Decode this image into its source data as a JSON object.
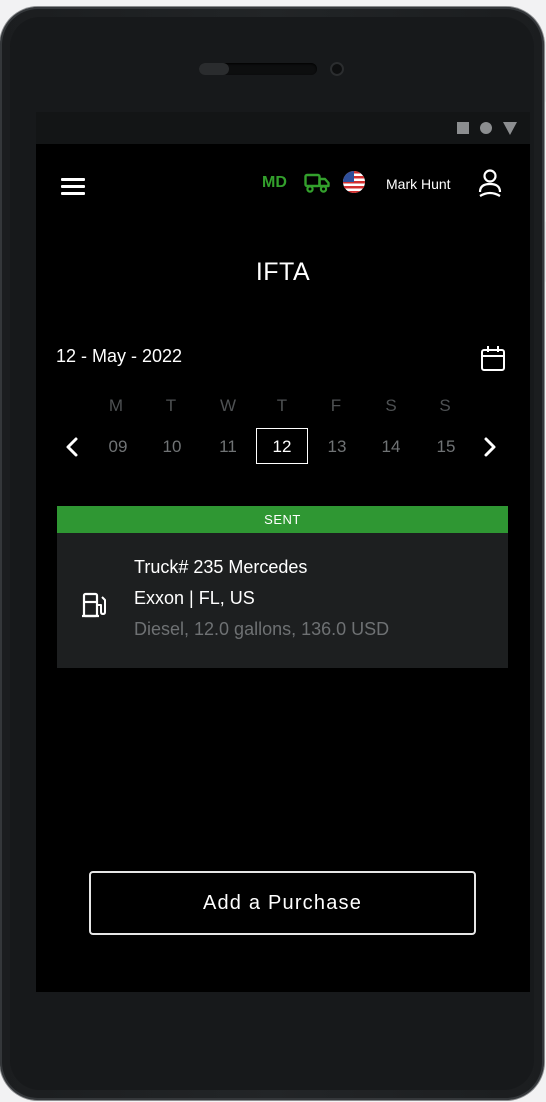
{
  "header": {
    "state_code": "MD",
    "user_name": "Mark Hunt",
    "icons": [
      "menu-icon",
      "truck-icon",
      "us-flag-icon",
      "user-icon"
    ]
  },
  "page": {
    "title": "IFTA"
  },
  "date_selector": {
    "current_date": "12 - May - 2022",
    "weekdays": [
      "M",
      "T",
      "W",
      "T",
      "F",
      "S",
      "S"
    ],
    "days": [
      "09",
      "10",
      "11",
      "12",
      "13",
      "14",
      "15"
    ],
    "selected_day": "12"
  },
  "purchase_card": {
    "status": "SENT",
    "line1": "Truck# 235 Mercedes",
    "line2": "Exxon | FL, US",
    "line3": "Diesel, 12.0 gallons, 136.0 USD",
    "icon": "fuel-pump-icon"
  },
  "actions": {
    "add_purchase": "Add a Purchase"
  },
  "colors": {
    "accent_green": "#2f9733",
    "md_green": "#33a02c",
    "screen_bg": "#000000",
    "card_bg": "#1d1f20"
  }
}
